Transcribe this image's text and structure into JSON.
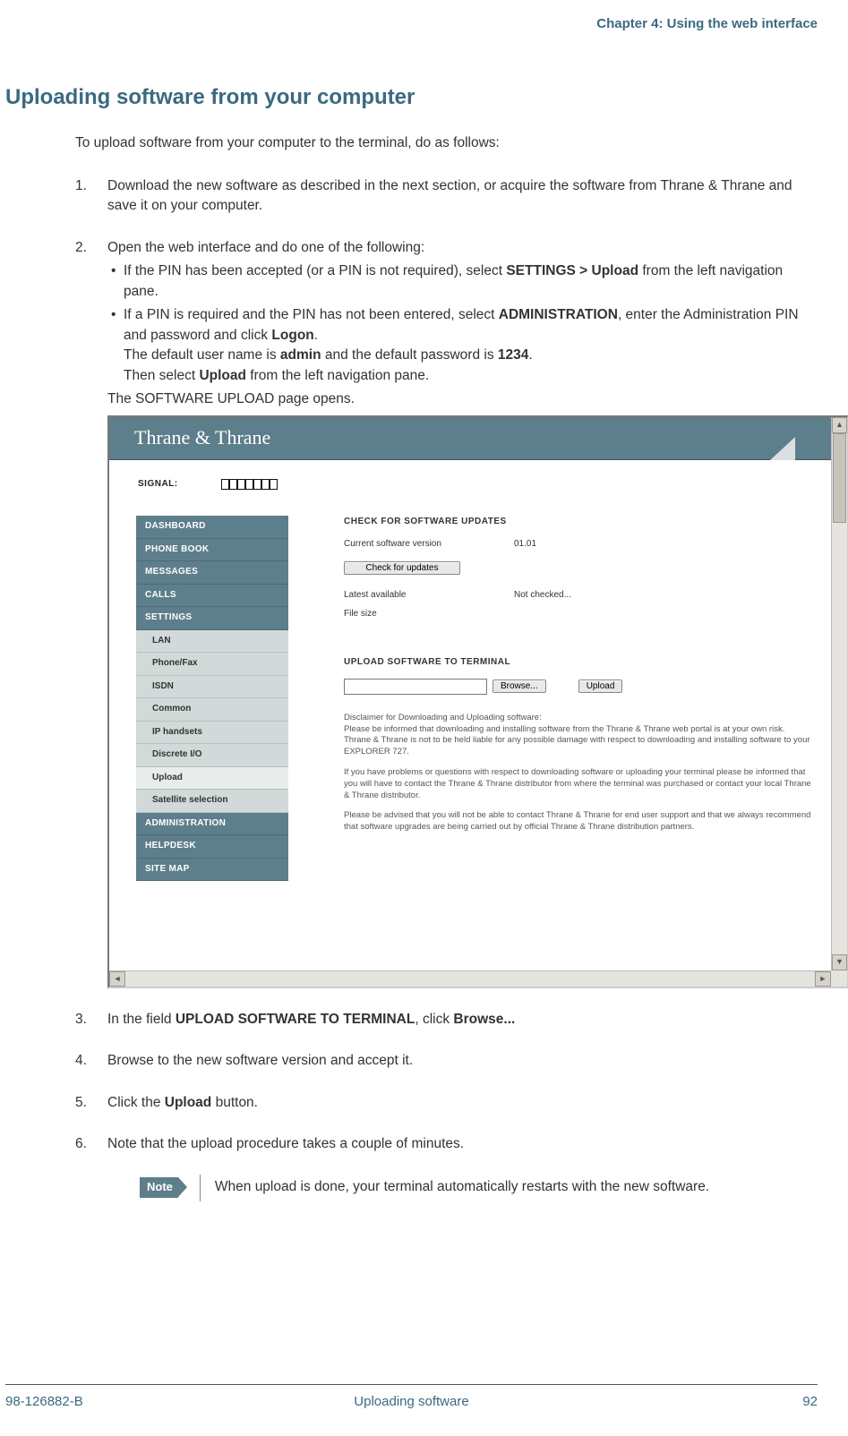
{
  "chapter_header": "Chapter 4: Using the web interface",
  "page_title": "Uploading software from your computer",
  "intro": "To upload software from your computer to the terminal, do as follows:",
  "steps": {
    "s1": "Download the new software as described in the next section, or acquire the software from Thrane & Thrane and save it on your computer.",
    "s2_lead": "Open the web interface and do one of the following:",
    "s2_b1_a": "If the PIN has been accepted (or a PIN is not required), select ",
    "s2_b1_b": "SETTINGS > Upload",
    "s2_b1_c": " from the left navigation pane.",
    "s2_b2_a": "If a PIN is required and the PIN has not been entered, select ",
    "s2_b2_b": "ADMINISTRATION",
    "s2_b2_c": ", enter the Administration PIN and password and click ",
    "s2_b2_d": "Logon",
    "s2_b2_e": ".",
    "s2_b2_line2_a": "The default user name is ",
    "s2_b2_line2_b": "admin",
    "s2_b2_line2_c": " and the default password is ",
    "s2_b2_line2_d": "1234",
    "s2_b2_line2_e": ".",
    "s2_b2_line3_a": "Then select ",
    "s2_b2_line3_b": "Upload",
    "s2_b2_line3_c": " from the left navigation pane.",
    "s2_after": "The SOFTWARE UPLOAD page opens.",
    "s3_a": "In the field ",
    "s3_b": "UPLOAD SOFTWARE TO TERMINAL",
    "s3_c": ", click ",
    "s3_d": "Browse...",
    "s4": "Browse to the new software version and accept it.",
    "s5_a": "Click the ",
    "s5_b": "Upload",
    "s5_c": " button.",
    "s6": "Note that the upload procedure takes a couple of minutes."
  },
  "note_label": "Note",
  "note_text": "When upload is done, your terminal automatically restarts with the new software.",
  "screenshot": {
    "brand": "Thrane & Thrane",
    "signal_label": "SIGNAL:",
    "sidebar": {
      "dashboard": "DASHBOARD",
      "phone_book": "PHONE BOOK",
      "messages": "MESSAGES",
      "calls": "CALLS",
      "settings": "SETTINGS",
      "lan": "LAN",
      "phone_fax": "Phone/Fax",
      "isdn": "ISDN",
      "common": "Common",
      "ip_handsets": "IP handsets",
      "discrete_io": "Discrete I/O",
      "upload": "Upload",
      "satellite": "Satellite selection",
      "administration": "ADMINISTRATION",
      "helpdesk": "HELPDESK",
      "site_map": "SITE MAP"
    },
    "content": {
      "check_title": "CHECK FOR SOFTWARE UPDATES",
      "current_label": "Current software version",
      "current_value": "01.01",
      "check_btn": "Check for updates",
      "latest_label": "Latest available",
      "latest_value": "Not checked...",
      "file_size_label": "File size",
      "upload_title": "UPLOAD SOFTWARE TO TERMINAL",
      "browse_btn": "Browse...",
      "upload_btn": "Upload",
      "disclaimer_p1": "Disclaimer for Downloading and Uploading software:\nPlease be informed that downloading and installing software from the Thrane & Thrane web portal is at your own risk. Thrane & Thrane is not to be held liable for any possible damage with respect to downloading and installing software to your EXPLORER 727.",
      "disclaimer_p2": "If you have problems or questions with respect to downloading software or uploading your terminal please be informed that you will have to contact the Thrane & Thrane distributor from where the terminal was purchased or contact your local Thrane & Thrane distributor.",
      "disclaimer_p3": "Please be advised that you will not be able to contact Thrane & Thrane for end user support and that we always recommend that software upgrades are being carried out by official Thrane & Thrane distribution partners."
    }
  },
  "footer": {
    "left": "98-126882-B",
    "mid": "Uploading software",
    "right": "92"
  }
}
